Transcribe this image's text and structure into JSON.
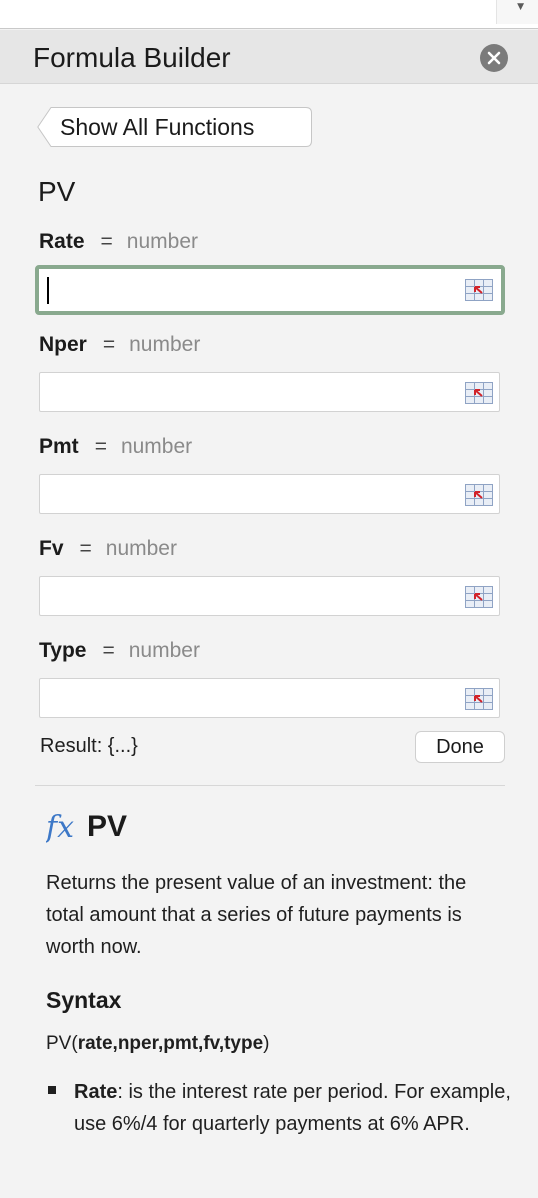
{
  "panel": {
    "title": "Formula Builder"
  },
  "back_button": {
    "label": "Show All Functions"
  },
  "function": {
    "name": "PV"
  },
  "arguments": [
    {
      "name": "Rate",
      "eq": "=",
      "type": "number",
      "value": ""
    },
    {
      "name": "Nper",
      "eq": "=",
      "type": "number",
      "value": ""
    },
    {
      "name": "Pmt",
      "eq": "=",
      "type": "number",
      "value": ""
    },
    {
      "name": "Fv",
      "eq": "=",
      "type": "number",
      "value": ""
    },
    {
      "name": "Type",
      "eq": "=",
      "type": "number",
      "value": ""
    }
  ],
  "result": {
    "text": "Result: {...}"
  },
  "done_button": {
    "label": "Done"
  },
  "help": {
    "name": "PV",
    "description": "Returns the present value of an investment: the total amount that a series of future payments is worth now.",
    "syntax_heading": "Syntax",
    "syntax_prefix": "PV(",
    "syntax_args": "rate,nper,pmt,fv,type",
    "syntax_suffix": ")",
    "bullet_term": "Rate",
    "bullet_text": ": is the interest rate per period. For example, use 6%/4 for quarterly payments at 6% APR."
  },
  "icons": {
    "close": "close-icon",
    "back": "chevron-left-icon",
    "cell_reference": "cell-reference-icon",
    "function": "fx-icon"
  },
  "colors": {
    "focus_border": "#89a98e",
    "fx_blue": "#3d78c7",
    "header_bg": "#e6e6e6",
    "panel_bg": "#f3f3f3"
  }
}
